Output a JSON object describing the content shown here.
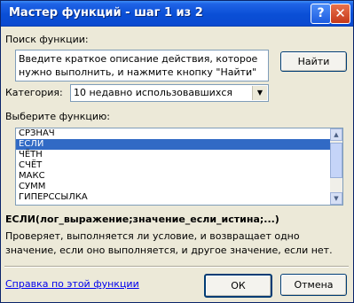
{
  "window": {
    "title": "Мастер функций - шаг 1 из 2",
    "help_btn": "?",
    "close_btn": "✕"
  },
  "search": {
    "label": "Поиск функции:",
    "text": "Введите краткое описание действия, которое нужно выполнить, и нажмите кнопку \"Найти\"",
    "find_label": "Найти"
  },
  "category": {
    "label": "Категория:",
    "value": "10 недавно использовавшихся"
  },
  "functions": {
    "label": "Выберите функцию:",
    "items": [
      "СРЗНАЧ",
      "ЕСЛИ",
      "ЧЁТН",
      "СЧЁТ",
      "МАКС",
      "СУММ",
      "ГИПЕРССЫЛКА"
    ],
    "selected_index": 1
  },
  "syntax": "ЕСЛИ(лог_выражение;значение_если_истина;...)",
  "description": "Проверяет, выполняется ли условие, и возвращает одно значение, если оно выполняется, и другое значение, если нет.",
  "footer": {
    "help_link": "Справка по этой функции",
    "ok_label": "ОК",
    "cancel_label": "Отмена"
  },
  "icons": {
    "dropdown": "chevron-down-icon",
    "scroll_up": "arrow-up-icon",
    "scroll_down": "arrow-down-icon"
  }
}
